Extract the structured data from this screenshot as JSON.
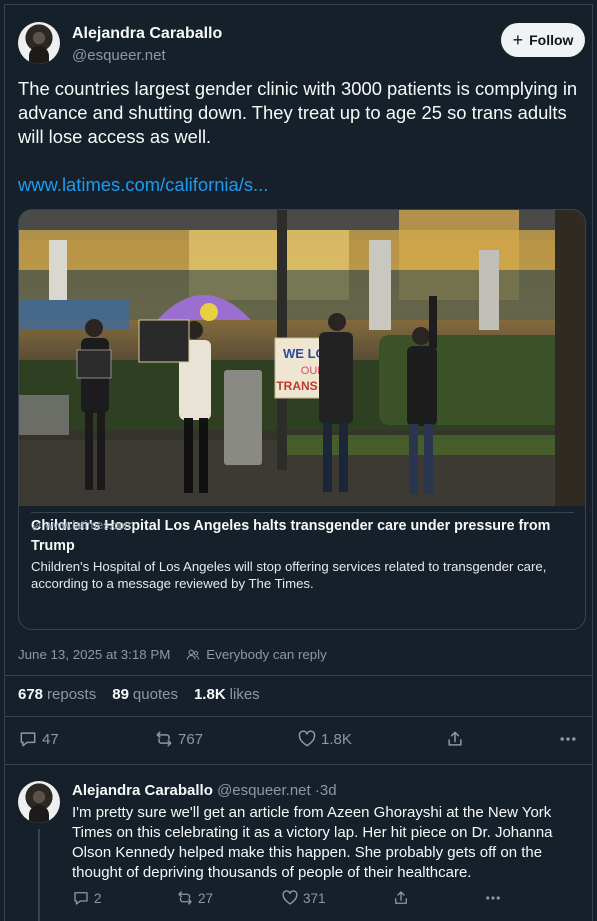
{
  "author": {
    "name": "Alejandra Caraballo",
    "handle": "@esqueer.net"
  },
  "follow_label": "Follow",
  "tweet": {
    "text": "The countries largest gender clinic with 3000 patients is complying in advance and shutting down. They treat up to age 25 so trans adults will lose access as well.",
    "link": "www.latimes.com/california/s..."
  },
  "card": {
    "image_sign": {
      "line1": "WE LOVE",
      "line2": "OUR",
      "line3": "TRANS KIDS"
    },
    "title": "Children's Hospital Los Angeles halts transgender care under pressure from Trump",
    "description": "Children's Hospital of Los Angeles will stop offering services related to transgender care, according to a message reviewed by The Times.",
    "domain": "www.latimes.com"
  },
  "meta": {
    "timestamp": "June 13, 2025 at 3:18 PM",
    "reply_setting": "Everybody can reply"
  },
  "stats": {
    "reposts_count": "678",
    "reposts_label": "reposts",
    "quotes_count": "89",
    "quotes_label": "quotes",
    "likes_count": "1.8K",
    "likes_label": "likes"
  },
  "actions": {
    "replies": "47",
    "retweets": "767",
    "likes": "1.8K"
  },
  "reply": {
    "name": "Alejandra Caraballo",
    "handle": "@esqueer.net",
    "dot": "·",
    "time": "3d",
    "text": "I'm pretty sure we'll get an article from Azeen Ghorayshi at the New York Times on this celebrating it as a victory lap. Her hit piece on Dr. Johanna Olson Kennedy helped make this happen. She probably gets off on the thought of depriving thousands of people of their healthcare.",
    "actions": {
      "replies": "2",
      "retweets": "27",
      "likes": "371"
    }
  },
  "colors": {
    "background": "#15202b",
    "link": "#1d9bf0",
    "muted": "#8b98a5",
    "border": "#38444d"
  }
}
